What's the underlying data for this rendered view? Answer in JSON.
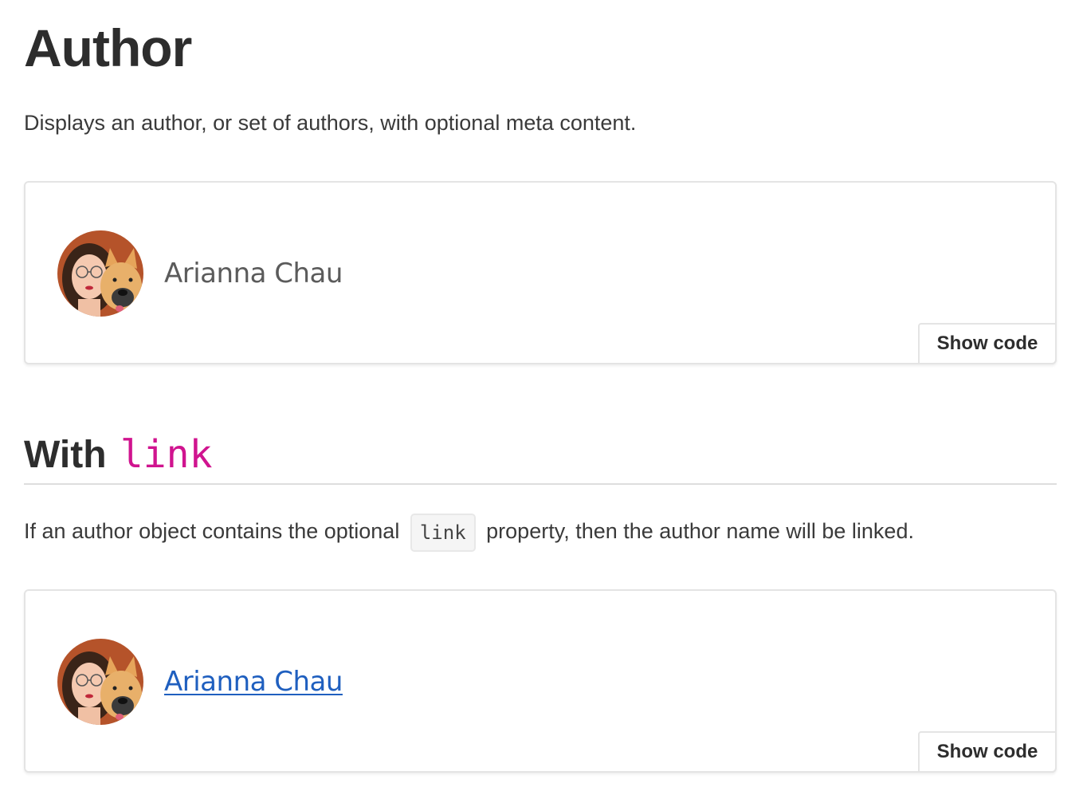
{
  "page": {
    "title": "Author",
    "description": "Displays an author, or set of authors, with optional meta content."
  },
  "demos": [
    {
      "author_name": "Arianna Chau",
      "show_code_label": "Show code"
    },
    {
      "author_name": "Arianna Chau",
      "show_code_label": "Show code"
    }
  ],
  "section_link": {
    "heading_prefix": "With",
    "heading_code": "link",
    "description_before": "If an author object contains the optional",
    "description_code": "link",
    "description_after": "property, then the author name will be linked."
  },
  "colors": {
    "link": "#1f5fbf",
    "code_accent": "#d0148f"
  },
  "icons": {
    "avatar": "avatar-woman-with-dog-illustration"
  }
}
